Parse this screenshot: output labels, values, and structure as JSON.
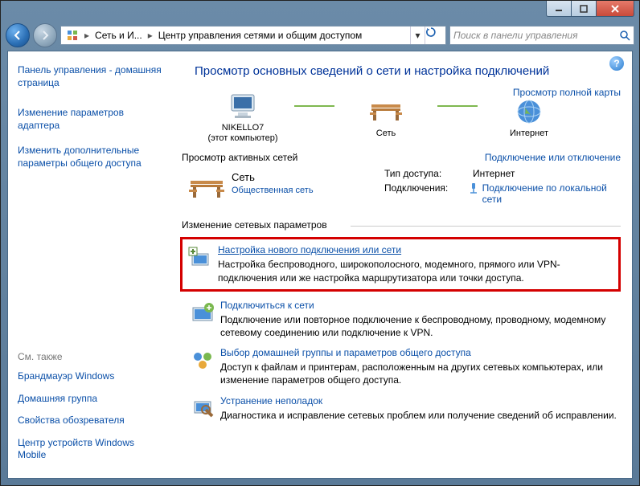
{
  "addressbar": {
    "segment1": "Сеть и И...",
    "segment2": "Центр управления сетями и общим доступом"
  },
  "search": {
    "placeholder": "Поиск в панели управления"
  },
  "sidebar": {
    "home": "Панель управления - домашняя страница",
    "adapter": "Изменение параметров адаптера",
    "sharing": "Изменить дополнительные параметры общего доступа",
    "see_also": "См. также",
    "firewall": "Брандмауэр Windows",
    "homegroup": "Домашняя группа",
    "internet_options": "Свойства обозревателя",
    "mobile": "Центр устройств Windows Mobile"
  },
  "heading": "Просмотр основных сведений о сети и настройка подключений",
  "map_link": "Просмотр полной карты",
  "nodes": {
    "computer": "NIKELLO7",
    "computer_sub": "(этот компьютер)",
    "network": "Сеть",
    "internet": "Интернет"
  },
  "active": {
    "section": "Просмотр активных сетей",
    "right_link": "Подключение или отключение",
    "net_name": "Сеть",
    "net_type": "Общественная сеть",
    "access_label": "Тип доступа:",
    "access_value": "Интернет",
    "conn_label": "Подключения:",
    "conn_value": "Подключение по локальной сети"
  },
  "change_section": "Изменение сетевых параметров",
  "tasks": {
    "t1_title": "Настройка нового подключения или сети",
    "t1_desc": "Настройка беспроводного, широкополосного, модемного, прямого или VPN-подключения или же настройка маршрутизатора или точки доступа.",
    "t2_title": "Подключиться к сети",
    "t2_desc": "Подключение или повторное подключение к беспроводному, проводному, модемному сетевому соединению или подключение к VPN.",
    "t3_title": "Выбор домашней группы и параметров общего доступа",
    "t3_desc": "Доступ к файлам и принтерам, расположенным на других сетевых компьютерах, или изменение параметров общего доступа.",
    "t4_title": "Устранение неполадок",
    "t4_desc": "Диагностика и исправление сетевых проблем или получение сведений об исправлении."
  }
}
